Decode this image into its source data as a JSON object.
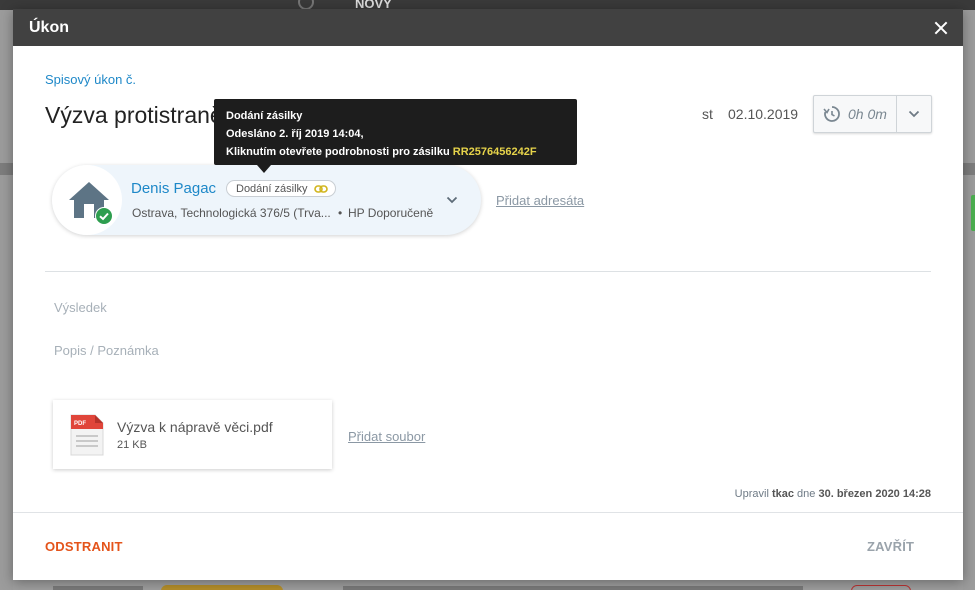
{
  "background": {
    "new_label": "NOVÝ"
  },
  "modal": {
    "title": "Úkon",
    "subtitle": "Spisový úkon č.",
    "heading": "Výzva protistraně k nápravě věci",
    "day": "st",
    "date": "02.10.2019",
    "timer": {
      "value": "0h 0m",
      "icon": "timer-icon"
    }
  },
  "tooltip": {
    "line1": "Dodání zásilky",
    "line2": "Odesláno 2. říj 2019 14:04,",
    "line3_prefix": "Kliknutím otevřete podrobnosti pro zásilku ",
    "tracking": "RR2576456242F"
  },
  "recipient": {
    "name": "Denis Pagac",
    "badge": "Dodání zásilky",
    "address": "Ostrava, Technologická 376/5 (Trva...",
    "dot": "•",
    "delivery_type": "HP Doporučeně",
    "icon": "house-icon",
    "status_icon": "check-icon"
  },
  "add_recipient": "Přidat adresáta",
  "fields": {
    "result_label": "Výsledek",
    "note_label": "Popis / Poznámka"
  },
  "file": {
    "name": "Výzva k nápravě věci.pdf",
    "size": "21 KB",
    "icon": "pdf-icon"
  },
  "add_file": "Přidat soubor",
  "edited": {
    "prefix": "Upravil",
    "user": "tkac",
    "middle": "dne",
    "datetime": "30. březen 2020 14:28"
  },
  "buttons": {
    "delete": "ODSTRANIT",
    "close": "ZAVŘÍT"
  },
  "colors": {
    "accent": "#1e88c8",
    "danger": "#e4541b",
    "header": "#414141",
    "tracking": "#e6d34a",
    "success": "#2e9e4f"
  }
}
